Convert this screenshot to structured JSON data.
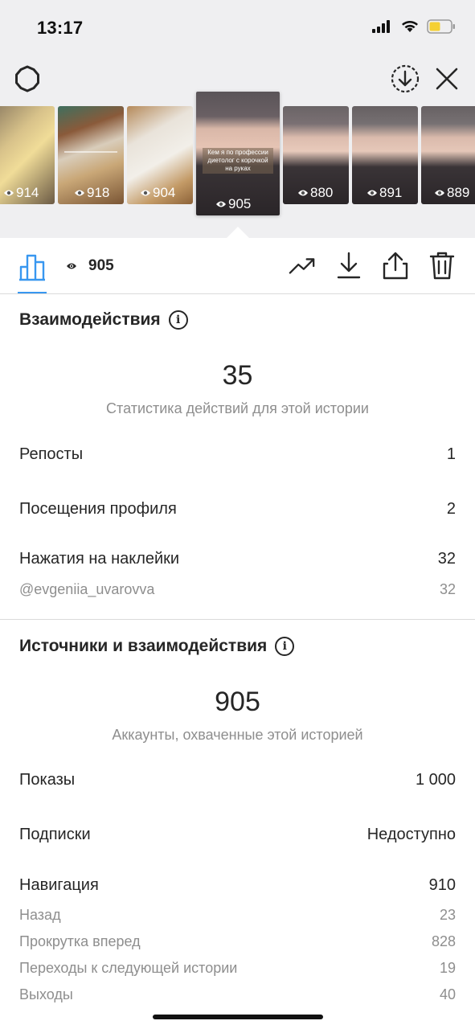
{
  "status_bar": {
    "time": "13:17"
  },
  "stories": [
    {
      "views": "914",
      "caption": ""
    },
    {
      "views": "918",
      "caption": ""
    },
    {
      "views": "904",
      "caption": ""
    },
    {
      "views": "905",
      "caption": "Кем я по профессии диетолог с корочкой на руках"
    },
    {
      "views": "880",
      "caption": ""
    },
    {
      "views": "891",
      "caption": ""
    },
    {
      "views": "889",
      "caption": ""
    }
  ],
  "tabbar": {
    "views_count": "905"
  },
  "interactions": {
    "title": "Взаимодействия",
    "total": "35",
    "total_caption": "Статистика действий для этой истории",
    "rows": [
      {
        "label": "Репосты",
        "value": "1"
      },
      {
        "label": "Посещения профиля",
        "value": "2"
      },
      {
        "label": "Нажатия на наклейки",
        "value": "32"
      }
    ],
    "sticker_sub": {
      "label": "@evgeniia_uvarovva",
      "value": "32"
    }
  },
  "discovery": {
    "title": "Источники и взаимодействия",
    "total": "905",
    "total_caption": "Аккаунты, охваченные этой историей",
    "rows": [
      {
        "label": "Показы",
        "value": "1 000"
      },
      {
        "label": "Подписки",
        "value": "Недоступно"
      },
      {
        "label": "Навигация",
        "value": "910"
      }
    ],
    "navigation_sub": [
      {
        "label": "Назад",
        "value": "23"
      },
      {
        "label": "Прокрутка вперед",
        "value": "828"
      },
      {
        "label": "Переходы к следующей истории",
        "value": "19"
      },
      {
        "label": "Выходы",
        "value": "40"
      }
    ]
  },
  "icons": {
    "settings": "gear-icon",
    "download_circle": "download-circle-icon",
    "close": "close-icon",
    "chart": "bar-chart-icon",
    "eye": "eye-icon",
    "promote": "trend-up-icon",
    "save": "download-icon",
    "share": "share-icon",
    "delete": "trash-icon",
    "info": "info-icon"
  },
  "colors": {
    "accent": "#3897f0",
    "battery": "#f5d033",
    "secondary_text": "#8e8e8e"
  }
}
